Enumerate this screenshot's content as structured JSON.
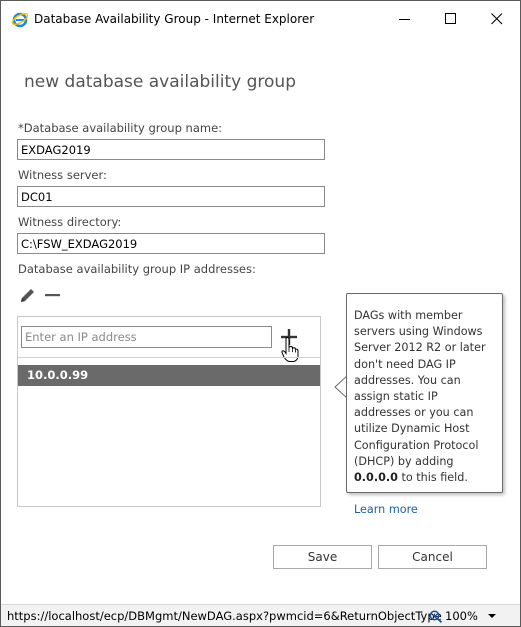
{
  "window": {
    "title": "Database Availability Group - Internet Explorer",
    "status_url": "https://localhost/ecp/DBMgmt/NewDAG.aspx?pwmcid=6&ReturnObjectType",
    "zoom": "100%"
  },
  "page": {
    "title": "new database availability group"
  },
  "form": {
    "name_label": "*Database availability group name:",
    "name_value": "EXDAG2019",
    "witness_server_label": "Witness server:",
    "witness_server_value": "DC01",
    "witness_directory_label": "Witness directory:",
    "witness_directory_value": "C:\\FSW_EXDAG2019",
    "ip_label": "Database availability group IP addresses:",
    "ip_placeholder": "Enter an IP address",
    "ip_addresses": [
      "10.0.0.99"
    ]
  },
  "callout": {
    "text_before": "DAGs with member servers using Windows Server 2012 R2 or later don't need DAG IP addresses. You can assign static IP addresses or you can utilize Dynamic Host Configuration Protocol (DHCP) by adding ",
    "bold_value": "0.0.0.0",
    "text_after": " to this field.",
    "link": "Learn more"
  },
  "buttons": {
    "save": "Save",
    "cancel": "Cancel"
  },
  "icons": {
    "app": "internet-explorer-icon",
    "minimize": "minimize-icon",
    "maximize": "maximize-icon",
    "close": "close-icon",
    "edit": "pencil-icon",
    "remove": "minus-icon",
    "add": "plus-icon",
    "cursor": "hand-cursor-icon",
    "zoom": "zoom-icon",
    "dropdown": "chevron-down-icon"
  },
  "colors": {
    "selected_row": "#6a6a6a",
    "link": "#1f5fa8",
    "ie_blue": "#1e88e5",
    "ie_ring": "#f5c400"
  }
}
